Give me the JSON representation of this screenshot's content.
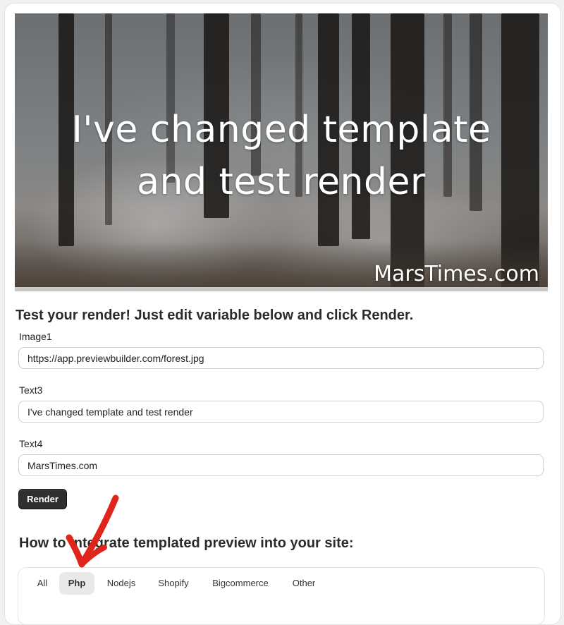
{
  "preview": {
    "headline": "I've changed template and test render",
    "site": "MarsTimes.com"
  },
  "form": {
    "title": "Test your render! Just edit variable below and click Render.",
    "fields": [
      {
        "label": "Image1",
        "value": "https://app.previewbuilder.com/forest.jpg"
      },
      {
        "label": "Text3",
        "value": "I've changed template and test render"
      },
      {
        "label": "Text4",
        "value": "MarsTimes.com"
      }
    ],
    "render_label": "Render"
  },
  "integrate": {
    "title": "How to integrate templated preview into your site:",
    "tabs": [
      "All",
      "Php",
      "Nodejs",
      "Shopify",
      "Bigcommerce",
      "Other"
    ],
    "active_tab": "Php"
  },
  "colors": {
    "annotation_arrow": "#e0261b",
    "button": "#2f2f2f"
  }
}
